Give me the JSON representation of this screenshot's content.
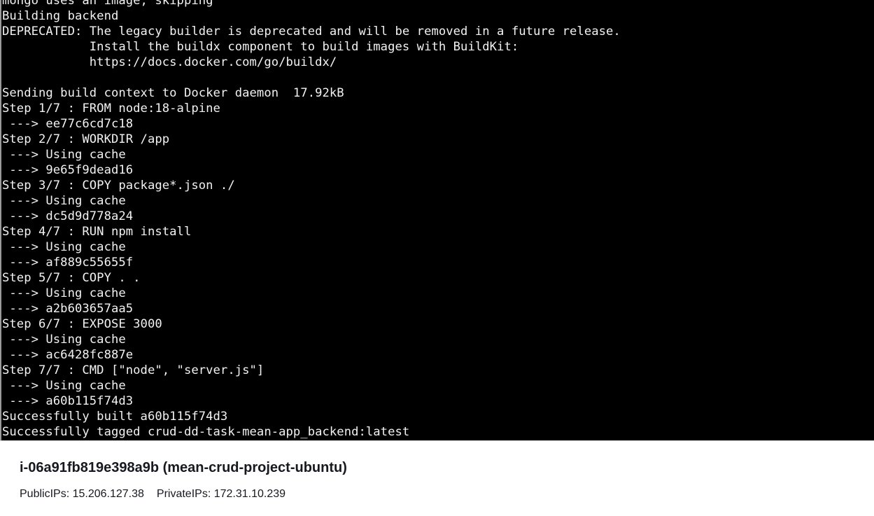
{
  "terminal": {
    "lines": [
      "mongo uses an image, skipping",
      "Building backend",
      "DEPRECATED: The legacy builder is deprecated and will be removed in a future release.",
      "            Install the buildx component to build images with BuildKit:",
      "            https://docs.docker.com/go/buildx/",
      "",
      "Sending build context to Docker daemon  17.92kB",
      "Step 1/7 : FROM node:18-alpine",
      " ---> ee77c6cd7c18",
      "Step 2/7 : WORKDIR /app",
      " ---> Using cache",
      " ---> 9e65f9dead16",
      "Step 3/7 : COPY package*.json ./",
      " ---> Using cache",
      " ---> dc5d9d778a24",
      "Step 4/7 : RUN npm install",
      " ---> Using cache",
      " ---> af889c55655f",
      "Step 5/7 : COPY . .",
      " ---> Using cache",
      " ---> a2b603657aa5",
      "Step 6/7 : EXPOSE 3000",
      " ---> Using cache",
      " ---> ac6428fc887e",
      "Step 7/7 : CMD [\"node\", \"server.js\"]",
      " ---> Using cache",
      " ---> a60b115f74d3",
      "Successfully built a60b115f74d3",
      "Successfully tagged crud-dd-task-mean-app_backend:latest"
    ]
  },
  "instance": {
    "title": "i-06a91fb819e398a9b (mean-crud-project-ubuntu)",
    "public_ips": "PublicIPs: 15.206.127.38",
    "private_ips": "PrivateIPs: 172.31.10.239"
  }
}
